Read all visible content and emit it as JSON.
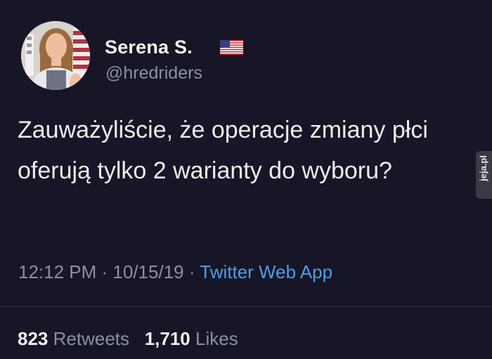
{
  "tweet": {
    "author": {
      "display_name": "Serena S.",
      "handle": "@hredriders",
      "flag_icon": "us-flag-icon"
    },
    "text": "Zauważyliście, że operacje zmiany płci oferują tylko 2 warianty do wyboru?",
    "meta": {
      "time": "12:12 PM",
      "separator": " · ",
      "date": "10/15/19",
      "source": "Twitter Web App"
    },
    "stats": {
      "retweets_count": "823",
      "retweets_label": "Retweets",
      "likes_count": "1,710",
      "likes_label": "Likes"
    }
  },
  "watermark": {
    "text": "jeja.pl"
  },
  "colors": {
    "background": "#161626",
    "text": "#ececf0",
    "secondary": "#8c8fa3",
    "link": "#4a9fe6",
    "divider": "#33354a"
  }
}
